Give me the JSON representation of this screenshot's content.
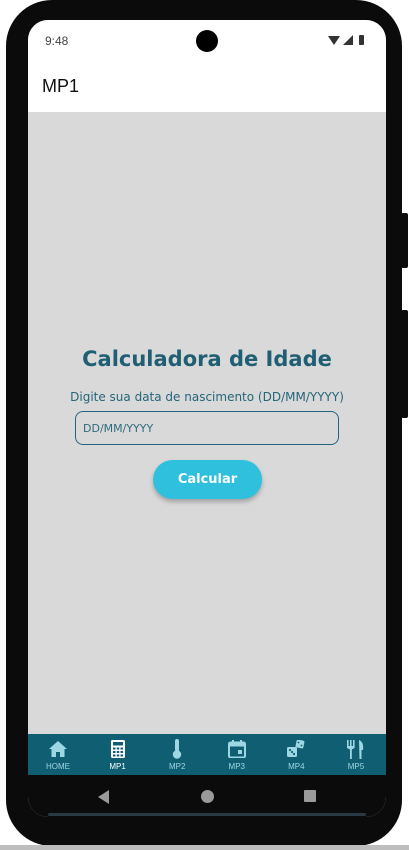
{
  "status": {
    "time": "9:48"
  },
  "appbar": {
    "title": "MP1"
  },
  "main": {
    "title": "Calculadora de Idade",
    "subtitle": "Digite sua data de nascimento (DD/MM/YYYY)",
    "input_placeholder": "DD/MM/YYYY",
    "input_value": "",
    "button_label": "Calcular"
  },
  "nav": {
    "items": [
      {
        "label": "HOME",
        "icon": "home-icon",
        "active": false
      },
      {
        "label": "MP1",
        "icon": "calculator-icon",
        "active": true
      },
      {
        "label": "MP2",
        "icon": "thermometer-icon",
        "active": false
      },
      {
        "label": "MP3",
        "icon": "calendar-icon",
        "active": false
      },
      {
        "label": "MP4",
        "icon": "dice-icon",
        "active": false
      },
      {
        "label": "MP5",
        "icon": "restaurant-icon",
        "active": false
      }
    ]
  },
  "colors": {
    "accent": "#2fc0dd",
    "title_text": "#1f5e73",
    "nav_background": "#0f5e72",
    "screen_background": "#d9d9d9"
  }
}
